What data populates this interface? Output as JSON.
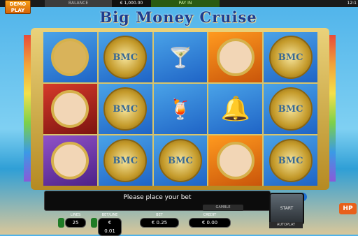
{
  "header": {
    "demo_play": "DEMO PLAY",
    "balance_label": "BALANCE",
    "balance_value": "€ 1,000.00",
    "pay_in": "PAY IN",
    "clock": "12:1"
  },
  "title": "Big Money Cruise",
  "reels": [
    [
      "compass",
      "bmc-coin",
      "bmc-coin-2"
    ],
    [
      "bmc-coin",
      "bmc-coin",
      "bmc-coin"
    ],
    [
      "cocktails",
      "cocktails",
      "bmc-coin"
    ],
    [
      "woman-portrait",
      "bell",
      "man-bald"
    ],
    [
      "bmc-coin",
      "bmc-coin",
      "bmc-coin"
    ]
  ],
  "coin_text": "BMC",
  "message": "Please place your bet",
  "gamble": "GAMBLE",
  "start": "START",
  "autoplay": "AUTOPLAY",
  "hp_badge": "HP",
  "info": "?",
  "lines_label": "LINES",
  "lines_value": "25",
  "betline_label": "BET/LINE",
  "betline_value": "€ 0.01",
  "bet_label": "BET",
  "bet_value": "€ 0.25",
  "credit_label": "CREDIT",
  "credit_value": "€ 0.00"
}
